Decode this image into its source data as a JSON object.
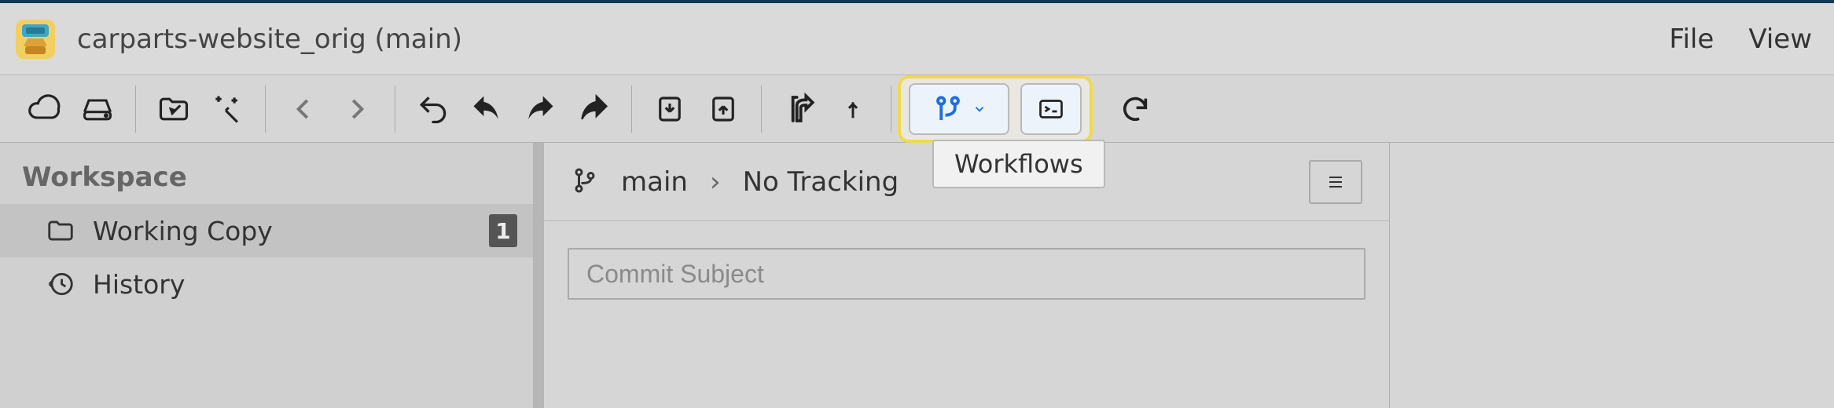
{
  "title": "carparts-website_orig (main)",
  "menu": {
    "file": "File",
    "view": "View"
  },
  "tooltip": "Workflows",
  "sidebar": {
    "header": "Workspace",
    "items": [
      {
        "label": "Working Copy",
        "badge": "1"
      },
      {
        "label": "History"
      }
    ]
  },
  "branch": {
    "name": "main",
    "tracking": "No Tracking"
  },
  "commit": {
    "placeholder": "Commit Subject"
  }
}
